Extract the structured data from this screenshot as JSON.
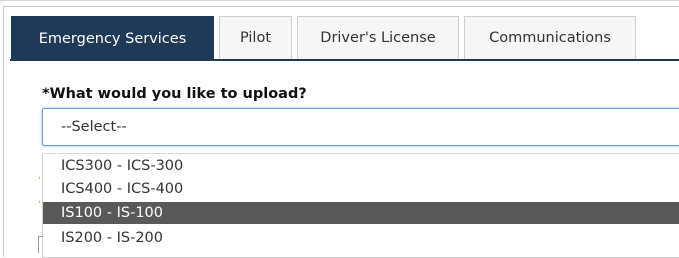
{
  "tabs": [
    {
      "label": "Emergency Services",
      "active": true
    },
    {
      "label": "Pilot",
      "active": false
    },
    {
      "label": "Driver's License",
      "active": false
    },
    {
      "label": "Communications",
      "active": false
    }
  ],
  "form": {
    "upload_label": "*What would you like to upload?",
    "select_value": "--Select--"
  },
  "dropdown": {
    "options": [
      {
        "label": "ICS300 - ICS-300",
        "highlighted": false
      },
      {
        "label": "ICS400 - ICS-400",
        "highlighted": false
      },
      {
        "label": "IS100 - IS-100",
        "highlighted": true
      },
      {
        "label": "IS200 - IS-200",
        "highlighted": false
      }
    ]
  },
  "colors": {
    "tab_active_bg": "#1f3a56",
    "option_highlight_bg": "#595959",
    "select_focus_border": "#6f9fd3"
  }
}
